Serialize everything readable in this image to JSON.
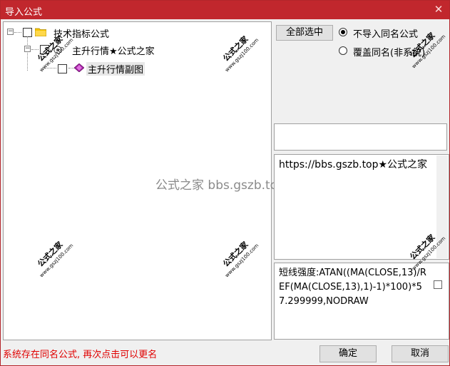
{
  "window": {
    "title": "导入公式",
    "close_glyph": "✕"
  },
  "tree": {
    "root_label": "技术指标公式",
    "child_label": "主升行情★公式之家",
    "leaf_label": "主升行情副图",
    "expander_glyph": "−"
  },
  "watermark": {
    "main": "公式之家",
    "sub": "www.gszj100.com",
    "center_text": "公式之家 bbs.gszb.top"
  },
  "options": {
    "select_all_label": "全部选中",
    "radio_no_import_label": "不导入同名公式",
    "radio_overwrite_label": "覆盖同名(非系统)",
    "selected_radio": "no_import"
  },
  "info": {
    "url_text": "https://bbs.gszb.top★公式之家",
    "formula_text": "短线强度:ATAN((MA(CLOSE,13)/REF(MA(CLOSE,13),1)-1)*100)*57.299999,NODRAW"
  },
  "footer": {
    "status_message": "系统存在同名公式, 再次点击可以更名",
    "confirm_label": "确定",
    "cancel_label": "取消"
  },
  "colors": {
    "titlebar": "#c1272d",
    "status_text": "#e00000",
    "folder": "#f5c400",
    "formula_icon": "#a020a0"
  }
}
